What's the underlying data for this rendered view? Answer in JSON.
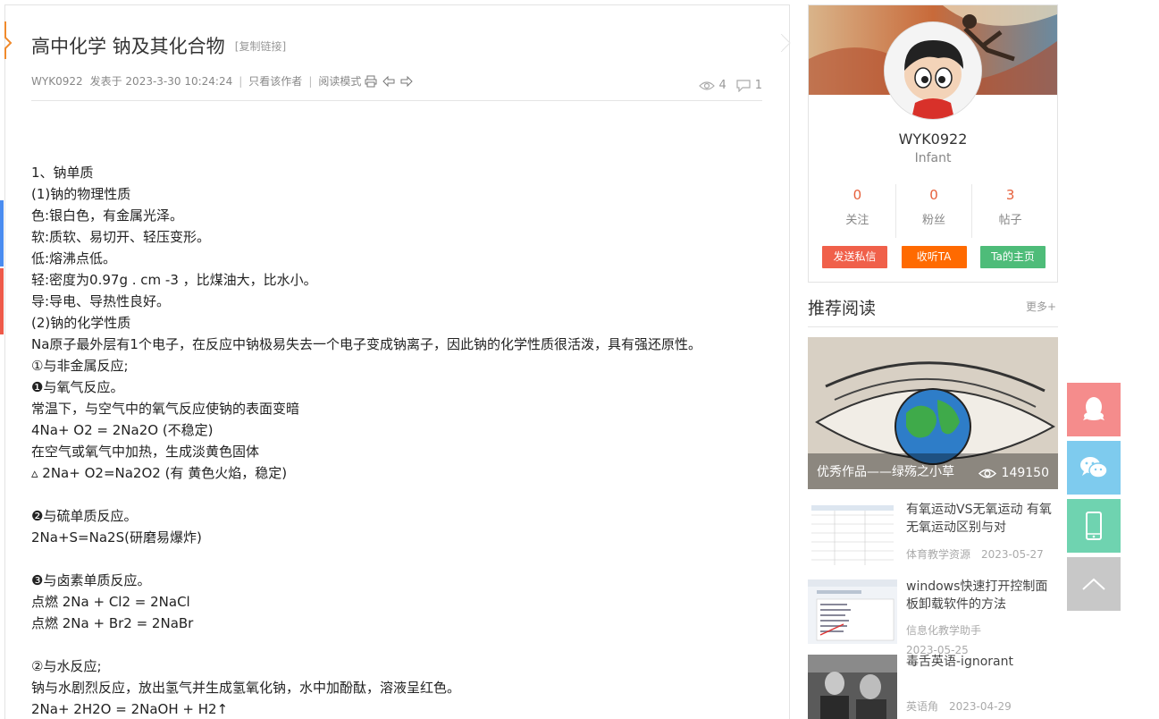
{
  "article": {
    "title": "高中化学 钠及其化合物",
    "copy_link": "[复制链接]",
    "author": "WYK0922",
    "posted": "发表于 2023-3-30 10:24:24",
    "only_author": "只看该作者",
    "read_mode": "阅读模式",
    "views": "4",
    "replies": "1",
    "lines": [
      "1、钠单质",
      "(1)钠的物理性质",
      "色:银白色，有金属光泽。",
      "软:质软、易切开、轻压变形。",
      "低:熔沸点低。",
      "轻:密度为0.97g . cm  -3  ，比煤油大，比水小。",
      "导:导电、导热性良好。",
      "(2)钠的化学性质",
      "Na原子最外层有1个电子，在反应中钠极易失去一个电子变成钠离子，因此钠的化学性质很活泼，具有强还原性。",
      "①与非金属反应;",
      "❶与氧气反应。",
      "常温下，与空气中的氧气反应使钠的表面变暗",
      "4Na+ O2 = 2Na2O (不稳定)",
      "在空气或氧气中加热，生成淡黄色固体",
      "▵  2Na+ O2=Na2O2 (有 黄色火焰，稳定)",
      "",
      "❷与硫单质反应。",
      "2Na+S=Na2S(研磨易爆炸)",
      "",
      "❸与卤素单质反应。",
      "点燃  2Na + Cl2 = 2NaCl",
      "点燃  2Na + Br2 = 2NaBr",
      "",
      "②与水反应;",
      "钠与水剧烈反应，放出氢气并生成氢氧化钠，水中加酚酞，溶液呈红色。",
      "2Na+ 2H2O = 2NaOH + H2↑"
    ]
  },
  "profile": {
    "name": "WYK0922",
    "rank": "Infant",
    "stats": [
      {
        "num": "0",
        "label": "关注"
      },
      {
        "num": "0",
        "label": "粉丝"
      },
      {
        "num": "3",
        "label": "帖子"
      }
    ],
    "buttons": {
      "message": "发送私信",
      "follow": "收听TA",
      "home": "Ta的主页"
    }
  },
  "recommend": {
    "heading": "推荐阅读",
    "more": "更多+",
    "featured": {
      "caption": "优秀作品——绿殇之小草",
      "views": "149150"
    },
    "items": [
      {
        "title": "有氧运动VS无氧运动 有氧无氧运动区别与对",
        "source": "体育教学资源",
        "date": "2023-05-27"
      },
      {
        "title": "windows快速打开控制面板卸载软件的方法",
        "source": "信息化教学助手",
        "date": "2023-05-25"
      },
      {
        "title": "毒舌英语-ignorant",
        "source": "英语角",
        "date": "2023-04-29"
      }
    ]
  },
  "side_tools": [
    "qq-icon",
    "wechat-icon",
    "phone-icon",
    "back-to-top-icon"
  ]
}
